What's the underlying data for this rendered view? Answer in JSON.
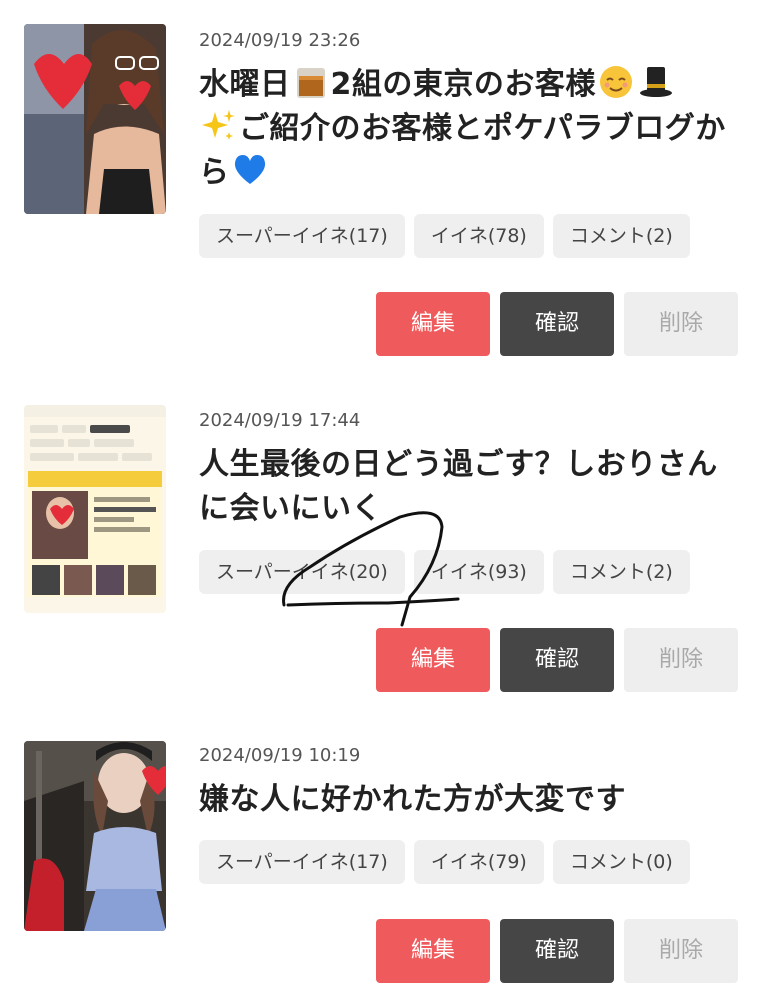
{
  "posts": [
    {
      "date": "2024/09/19 23:26",
      "title_parts": [
        "水曜日",
        "2組の東京のお客様",
        "",
        "ご紹介のお客様とポケパラブログから"
      ],
      "stats": {
        "super_like": "スーパーイイネ(17)",
        "like": "イイネ(78)",
        "comment": "コメント(2)"
      },
      "buttons": {
        "edit": "編集",
        "confirm": "確認",
        "delete": "削除"
      }
    },
    {
      "date": "2024/09/19 17:44",
      "title": "人生最後の日どう過ごす？しおりさんに会いにいく",
      "stats": {
        "super_like": "スーパーイイネ(20)",
        "like": "イイネ(93)",
        "comment": "コメント(2)"
      },
      "buttons": {
        "edit": "編集",
        "confirm": "確認",
        "delete": "削除"
      }
    },
    {
      "date": "2024/09/19 10:19",
      "title": "嫌な人に好かれた方が大変です",
      "stats": {
        "super_like": "スーパーイイネ(17)",
        "like": "イイネ(79)",
        "comment": "コメント(0)"
      },
      "buttons": {
        "edit": "編集",
        "confirm": "確認",
        "delete": "削除"
      }
    }
  ],
  "icons": [
    "whiskey-glass-emoji",
    "relieved-face-emoji",
    "top-hat-emoji",
    "sparkles-emoji",
    "blue-heart-emoji",
    "red-heart-sticker"
  ],
  "colors": {
    "edit": "#ef5a5c",
    "confirm": "#464646",
    "delete": "#eeeeee",
    "pill": "#efefef"
  }
}
